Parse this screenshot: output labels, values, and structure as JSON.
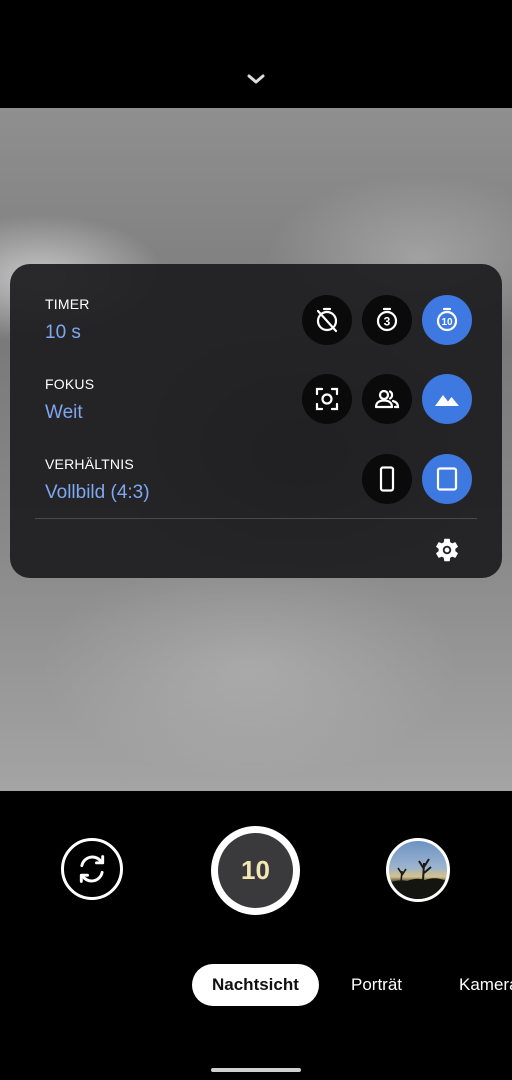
{
  "top": {
    "collapse_icon": "chevron-down-icon"
  },
  "panel": {
    "timer": {
      "label": "TIMER",
      "value": "10 s",
      "options": [
        {
          "icon": "timer-off-icon",
          "selected": false
        },
        {
          "icon": "timer-3-icon",
          "selected": false
        },
        {
          "icon": "timer-10-icon",
          "selected": true
        }
      ]
    },
    "focus": {
      "label": "FOKUS",
      "value": "Weit",
      "options": [
        {
          "icon": "face-focus-icon",
          "selected": false
        },
        {
          "icon": "people-icon",
          "selected": false
        },
        {
          "icon": "landscape-icon",
          "selected": true
        }
      ]
    },
    "ratio": {
      "label": "VERHÄLTNIS",
      "value": "Vollbild (4:3)",
      "options": [
        {
          "icon": "ratio-tall-icon",
          "selected": false
        },
        {
          "icon": "ratio-4-3-icon",
          "selected": true
        }
      ]
    },
    "settings_icon": "gear-icon"
  },
  "controls": {
    "switch_camera_icon": "switch-camera-icon",
    "shutter_countdown": "10",
    "gallery_thumbnail": "gallery-thumbnail"
  },
  "modes": [
    "Nachtsicht",
    "Porträt",
    "Kamera"
  ],
  "active_mode": "Nachtsicht",
  "colors": {
    "accent_selected": "#3d79e0",
    "value_text": "#7ea7f0",
    "panel_bg": "#1c1c1e",
    "shutter_number": "#f3e6b5"
  }
}
